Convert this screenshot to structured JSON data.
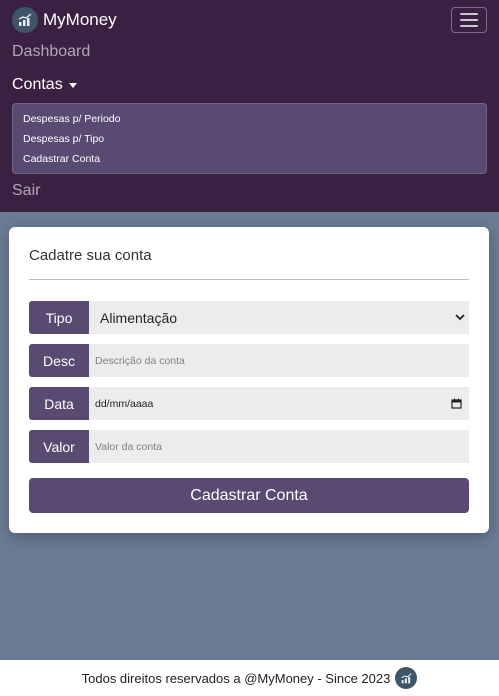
{
  "brand": {
    "name": "MyMoney",
    "logo_icon": "money-chart-logo-icon"
  },
  "nav": {
    "dashboard": "Dashboard",
    "contas": "Contas",
    "sair": "Sair",
    "dropdown_items": [
      "Despesas p/ Periodo",
      "Despesas p/ Tipo",
      "Cadastrar Conta"
    ]
  },
  "form": {
    "title": "Cadatre sua conta",
    "tipo_label": "Tipo",
    "tipo_value": "Alimentação",
    "desc_label": "Desc",
    "desc_placeholder": "Descrição da conta",
    "data_label": "Data",
    "data_value": "dd/mm/aaaa",
    "valor_label": "Valor",
    "valor_placeholder": "Valor da conta",
    "submit_label": "Cadastrar Conta"
  },
  "footer": {
    "text": "Todos direitos reservados a @MyMoney - Since 2023"
  },
  "colors": {
    "navbar": "#3a2142",
    "accent": "#594a72",
    "background": "#6a7b93",
    "logo_bg": "#3e5568"
  }
}
